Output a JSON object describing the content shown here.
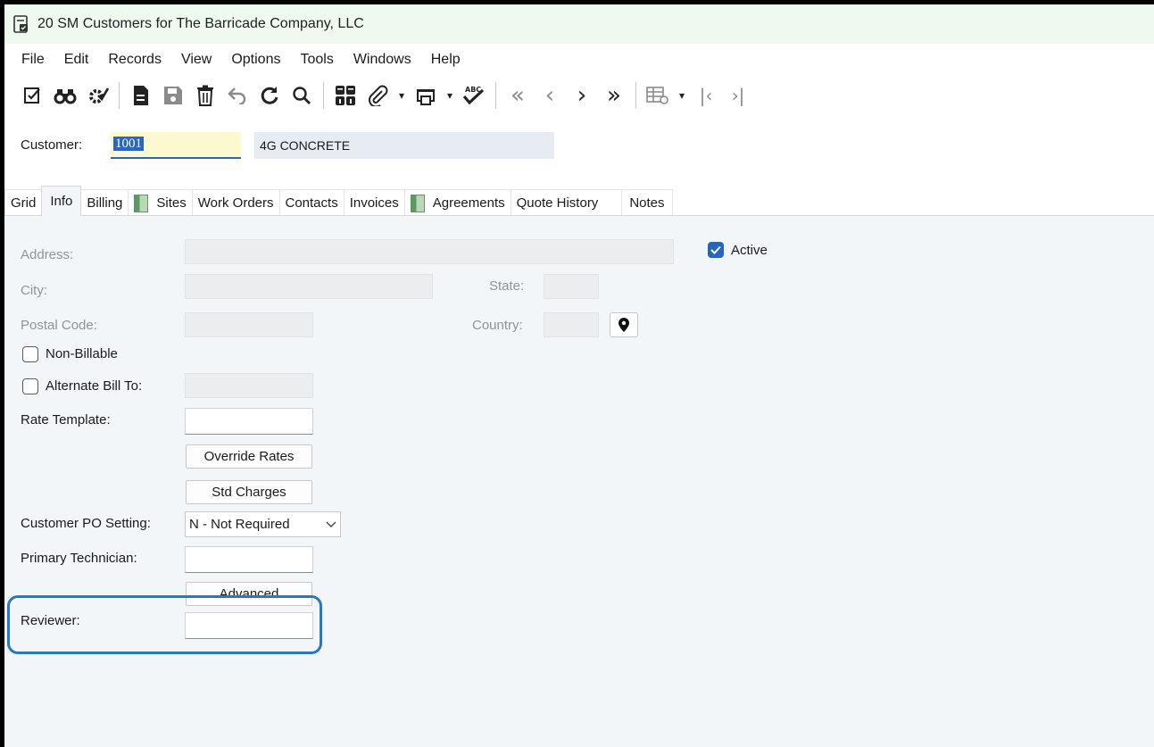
{
  "window": {
    "title": "20 SM Customers for The Barricade Company, LLC"
  },
  "menu": [
    "File",
    "Edit",
    "Records",
    "View",
    "Options",
    "Tools",
    "Windows",
    "Help"
  ],
  "toolbar": {
    "icons": [
      "edit-check-icon",
      "binoculars-icon",
      "settings-check-icon",
      "new-document-icon",
      "save-icon",
      "delete-icon",
      "undo-icon",
      "refresh-icon",
      "search-icon",
      "grid-icon",
      "attach-icon",
      "print-icon",
      "spellcheck-icon",
      "first-record-icon",
      "previous-record-icon",
      "next-record-icon",
      "last-record-icon",
      "table-settings-icon",
      "first-page-icon",
      "last-page-icon"
    ],
    "spell_label": "ABC"
  },
  "customer": {
    "label": "Customer:",
    "id": "1001",
    "name": "4G CONCRETE"
  },
  "tabs": [
    {
      "label": "Grid"
    },
    {
      "label": "Info",
      "active": true
    },
    {
      "label": "Billing"
    },
    {
      "label": "Sites",
      "icon": "sheet-icon"
    },
    {
      "label": "Work Orders"
    },
    {
      "label": "Contacts"
    },
    {
      "label": "Invoices"
    },
    {
      "label": "Agreements",
      "icon": "sheet-icon"
    },
    {
      "label": "Quote History"
    },
    {
      "label": "Notes"
    }
  ],
  "form": {
    "address_label": "Address:",
    "address_value": "",
    "active_label": "Active",
    "active_checked": true,
    "city_label": "City:",
    "state_label": "State:",
    "postal_label": "Postal Code:",
    "country_label": "Country:",
    "non_billable_label": "Non-Billable",
    "alternate_bill_label": "Alternate Bill To:",
    "rate_template_label": "Rate Template:",
    "override_rates_label": "Override Rates",
    "std_charges_label": "Std Charges",
    "customer_po_label": "Customer PO Setting:",
    "customer_po_value": "N - Not Required",
    "primary_tech_label": "Primary Technician:",
    "advanced_label": "Advanced",
    "reviewer_label": "Reviewer:"
  },
  "colors": {
    "accent": "#2466c2",
    "highlight": "#2c78bd",
    "titlebar": "#eefaef",
    "content_bg": "#f3f6f9"
  }
}
